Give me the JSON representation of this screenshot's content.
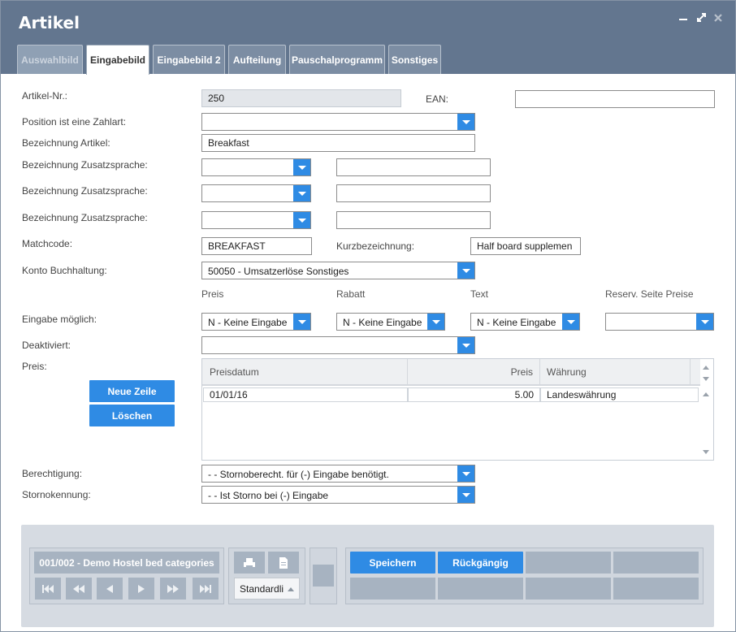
{
  "window": {
    "title": "Artikel",
    "controls": [
      "minimize-icon",
      "maximize-icon",
      "close-icon"
    ]
  },
  "tabs": [
    {
      "label": "Auswahlbild",
      "state": "disabled"
    },
    {
      "label": "Eingabebild",
      "state": "active"
    },
    {
      "label": "Eingabebild 2",
      "state": "normal"
    },
    {
      "label": "Aufteilung",
      "state": "normal"
    },
    {
      "label": "Pauschalprogramm",
      "state": "normal"
    },
    {
      "label": "Sonstiges",
      "state": "normal"
    }
  ],
  "form": {
    "artikel_nr": {
      "label": "Artikel-Nr.:",
      "value": "250"
    },
    "ean": {
      "label": "EAN:",
      "value": ""
    },
    "zahlart": {
      "label": "Position ist eine Zahlart:",
      "value": ""
    },
    "bezeichnung": {
      "label": "Bezeichnung Artikel:",
      "value": "Breakfast"
    },
    "zusatz": [
      {
        "label": "Bezeichnung Zusatzsprache:",
        "lang": "",
        "value": ""
      },
      {
        "label": "Bezeichnung Zusatzsprache:",
        "lang": "",
        "value": ""
      },
      {
        "label": "Bezeichnung Zusatzsprache:",
        "lang": "",
        "value": ""
      }
    ],
    "matchcode": {
      "label": "Matchcode:",
      "value": "BREAKFAST"
    },
    "kurzbezeichnung": {
      "label": "Kurzbezeichnung:",
      "value": "Half board supplemen"
    },
    "konto": {
      "label": "Konto Buchhaltung:",
      "value": "50050 - Umsatzerlöse Sonstiges"
    },
    "eingabe_headers": {
      "preis": "Preis",
      "rabatt": "Rabatt",
      "text": "Text",
      "reserv": "Reserv. Seite Preise"
    },
    "eingabe": {
      "label": "Eingabe möglich:",
      "preis": "N - Keine Eingabe",
      "rabatt": "N - Keine Eingabe",
      "text": "N - Keine Eingabe",
      "reserv": ""
    },
    "deaktiviert": {
      "label": "Deaktiviert:",
      "value": ""
    },
    "preis": {
      "label": "Preis:"
    },
    "berechtigung": {
      "label": "Berechtigung:",
      "value": "- - Stornoberecht. für (-) Eingabe benötigt."
    },
    "stornokennung": {
      "label": "Stornokennung:",
      "value": "- - Ist Storno bei (-) Eingabe"
    }
  },
  "price_buttons": {
    "new_row": "Neue Zeile",
    "delete": "Löschen"
  },
  "price_grid": {
    "columns": [
      "Preisdatum",
      "Preis",
      "Währung"
    ],
    "rows": [
      {
        "date": "01/01/16",
        "price": "5.00",
        "currency": "Landeswährung"
      }
    ]
  },
  "footer": {
    "record": "001/002 - Demo Hostel bed categories",
    "nav_icons": [
      "first-icon",
      "fast-back-icon",
      "prev-icon",
      "next-icon",
      "fast-forward-icon",
      "last-icon"
    ],
    "print_icons": [
      "print-icon",
      "document-icon"
    ],
    "layout_select": "Standardli",
    "save": "Speichern",
    "undo": "Rückgängig"
  },
  "colors": {
    "title_bar": "#63768f",
    "accent_blue": "#2f8be4",
    "footer_bg": "#d6dbe2",
    "disabled_button": "#a7b3c1"
  }
}
